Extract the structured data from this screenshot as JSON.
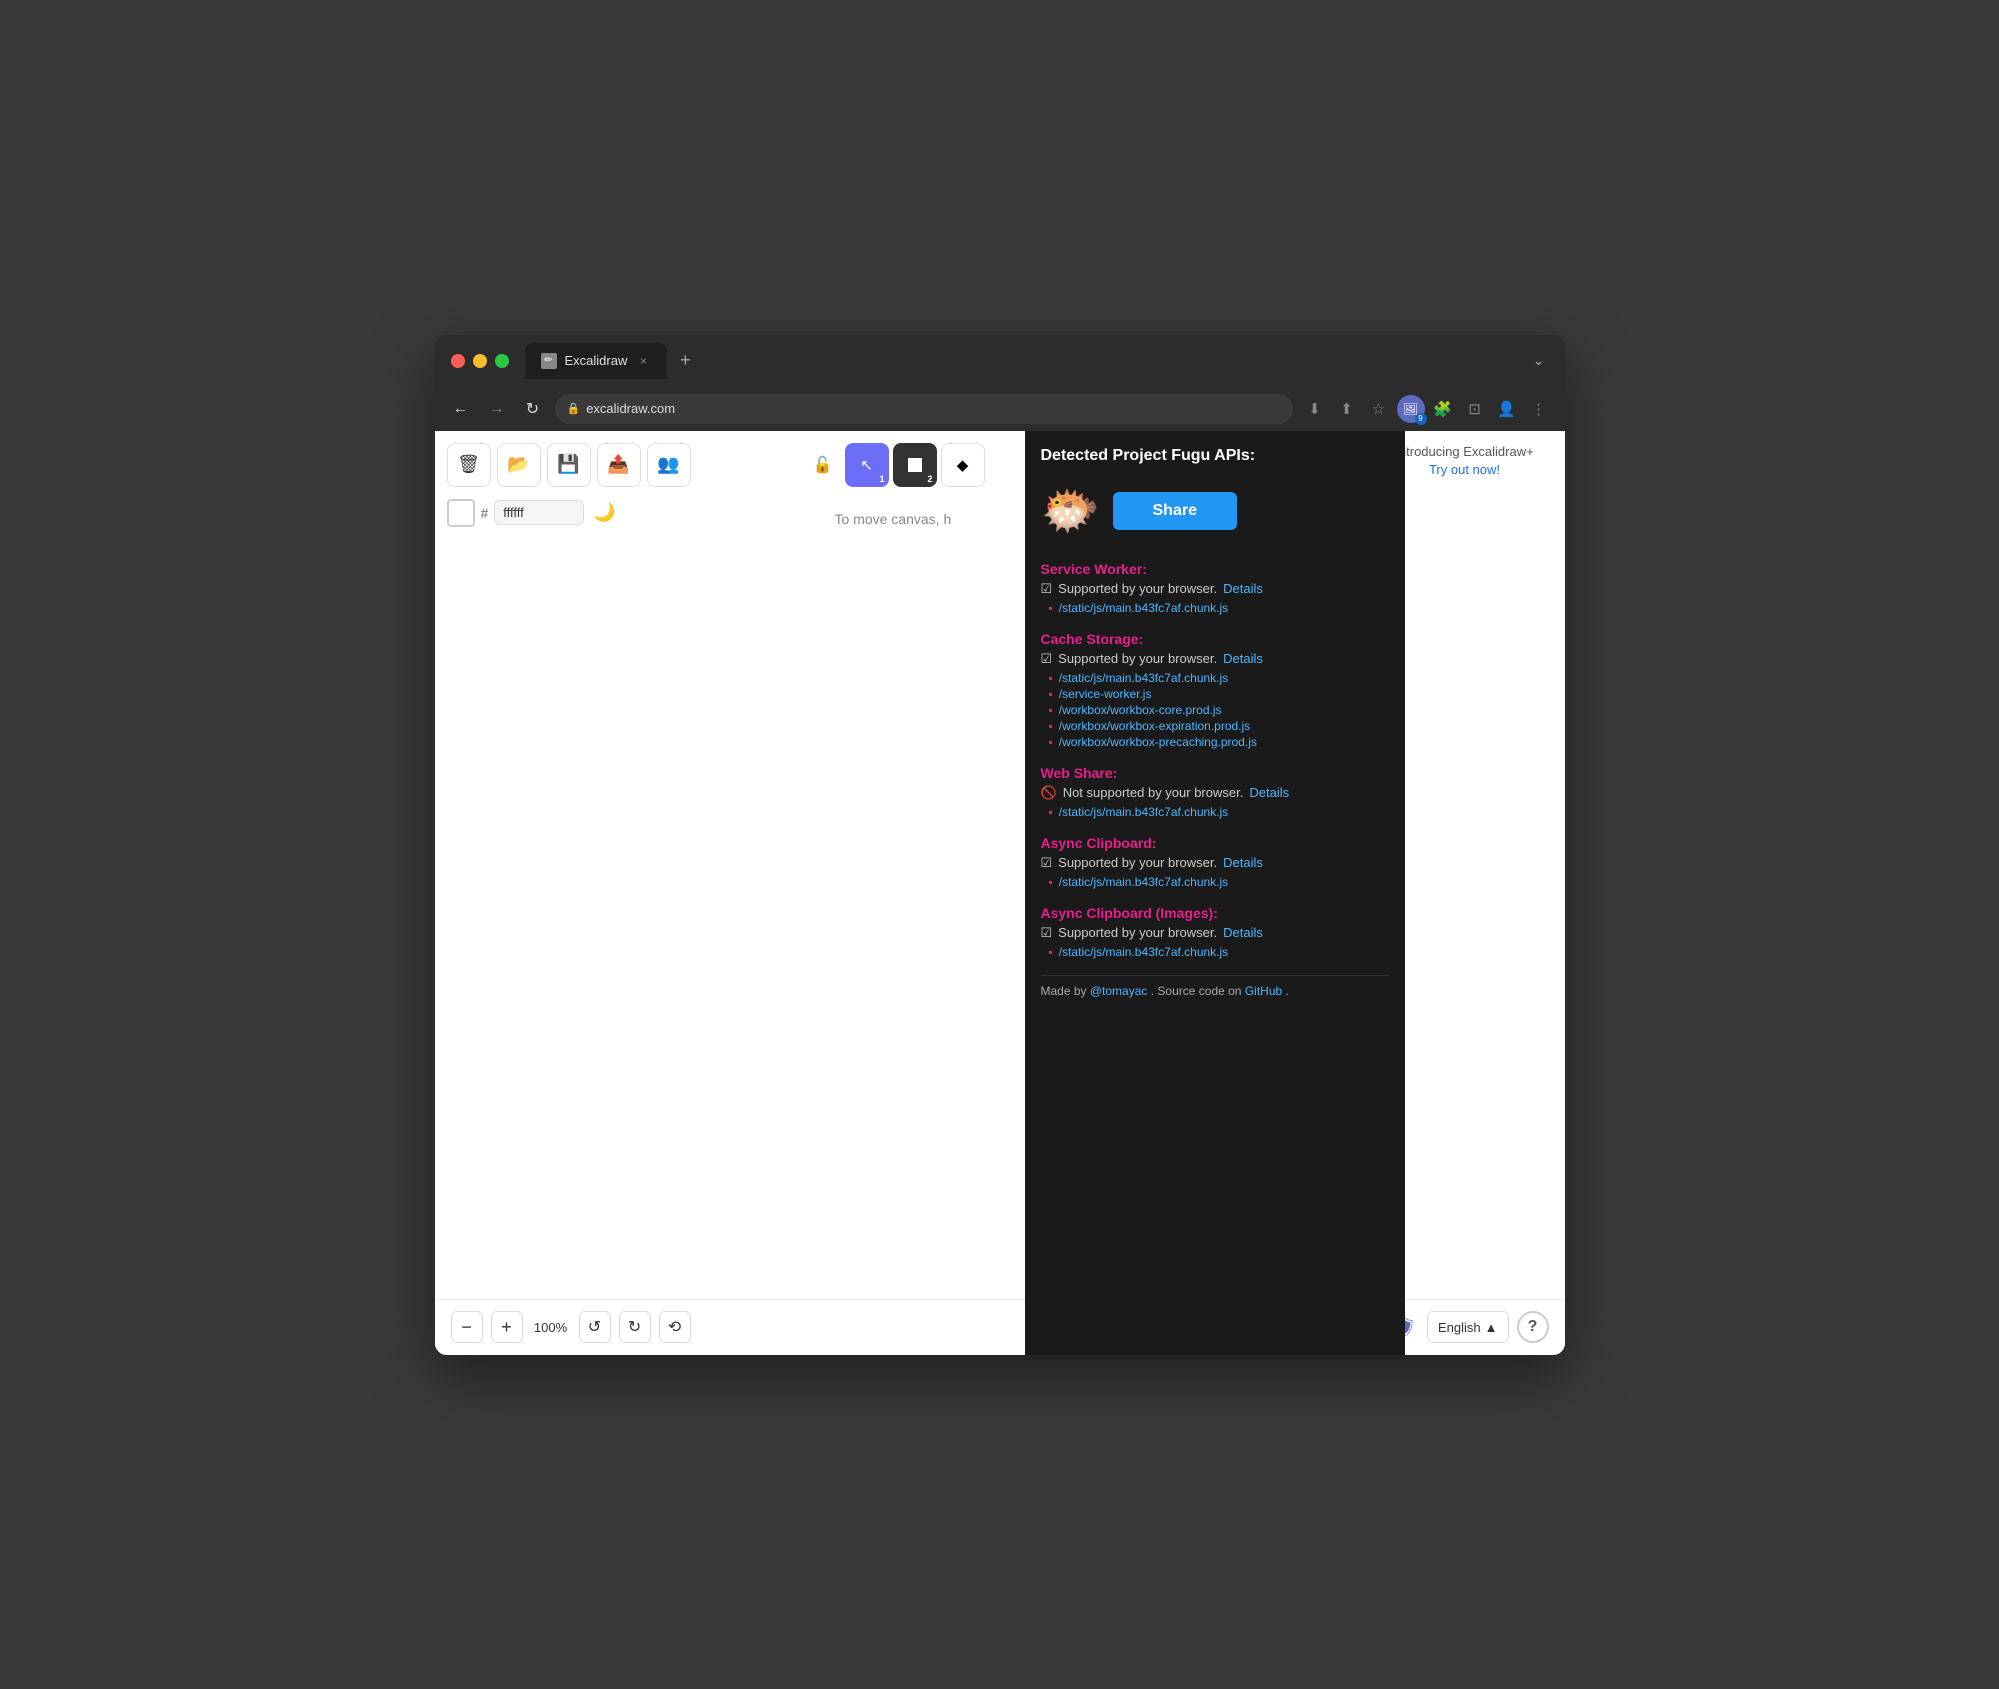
{
  "browser": {
    "tab_title": "Excalidraw",
    "tab_close": "×",
    "tab_new": "+",
    "tab_dropdown": "⌄",
    "url": "excalidraw.com",
    "nav": {
      "back": "←",
      "forward": "→",
      "refresh": "↻",
      "lock": "🔒",
      "download": "⬇",
      "share": "⬆",
      "bookmark": "☆",
      "extensions": "🧩",
      "split": "⊡",
      "profile": "👤",
      "more": "⋮"
    }
  },
  "toolbar": {
    "delete": "🗑",
    "open": "📂",
    "save": "💾",
    "export": "📤",
    "collab": "👥",
    "lock": "🔓",
    "cursor_label": "1",
    "rect_label": "2",
    "diamond": "◆",
    "color_hex": "ffffff",
    "dark_mode": "🌙"
  },
  "canvas_hint": "To move canvas, h",
  "right_panel": {
    "intro": "Introducing Excalidraw+",
    "cta": "Try out now!"
  },
  "fugu": {
    "title": "Detected Project Fugu APIs:",
    "share_button": "Share",
    "sections": [
      {
        "name": "Service Worker:",
        "supported": true,
        "status_text": "Supported by your browser.",
        "details_label": "Details",
        "files": [
          "/static/js/main.b43fc7af.chunk.js"
        ]
      },
      {
        "name": "Cache Storage:",
        "supported": true,
        "status_text": "Supported by your browser.",
        "details_label": "Details",
        "files": [
          "/static/js/main.b43fc7af.chunk.js",
          "/service-worker.js",
          "/workbox/workbox-core.prod.js",
          "/workbox/workbox-expiration.prod.js",
          "/workbox/workbox-precaching.prod.js"
        ]
      },
      {
        "name": "Web Share:",
        "supported": false,
        "status_text": "Not supported by your browser.",
        "details_label": "Details",
        "files": [
          "/static/js/main.b43fc7af.chunk.js"
        ]
      },
      {
        "name": "Async Clipboard:",
        "supported": true,
        "status_text": "Supported by your browser.",
        "details_label": "Details",
        "files": [
          "/static/js/main.b43fc7af.chunk.js"
        ]
      },
      {
        "name": "Async Clipboard (Images):",
        "supported": true,
        "status_text": "Supported by your browser.",
        "details_label": "Details",
        "files": [
          "/static/js/main.b43fc7af.chunk.js"
        ]
      }
    ],
    "footer_made_by": "Made by ",
    "footer_author": "@tomayac",
    "footer_source": ". Source code on ",
    "footer_github": "GitHub",
    "footer_end": "."
  },
  "bottom": {
    "zoom_minus": "−",
    "zoom_plus": "+",
    "zoom_level": "100%",
    "undo": "↺",
    "redo": "↻",
    "reset": "⟲",
    "language": "English",
    "lang_arrow": "▲",
    "help": "?"
  }
}
